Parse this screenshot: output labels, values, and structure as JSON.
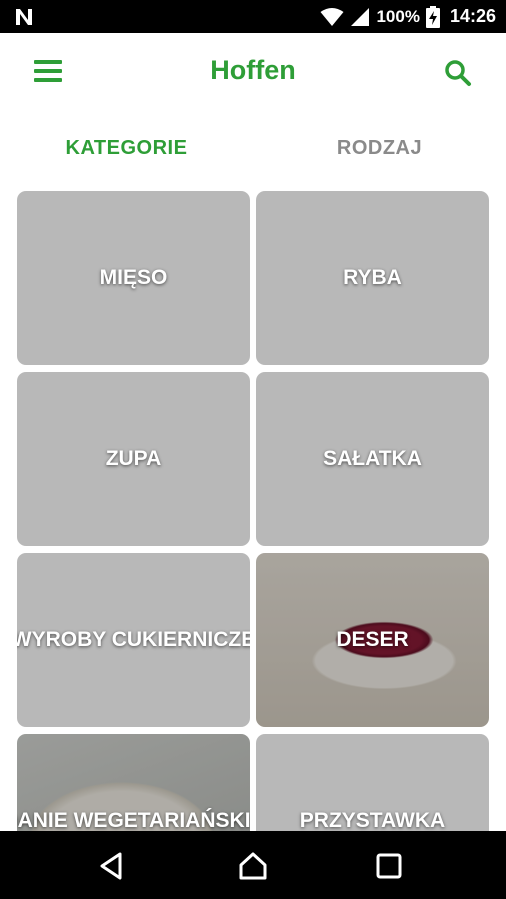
{
  "status_bar": {
    "battery_percent": "100%",
    "time": "14:26",
    "icons": [
      "n-icon",
      "wifi-icon",
      "signal-icon",
      "battery-charging-icon"
    ]
  },
  "app_bar": {
    "title": "Hoffen",
    "menu_icon": "hamburger-menu-icon",
    "search_icon": "search-icon"
  },
  "tabs": [
    {
      "label": "KATEGORIE",
      "active": true
    },
    {
      "label": "RODZAJ",
      "active": false
    }
  ],
  "categories": [
    {
      "label": "MIĘSO"
    },
    {
      "label": "RYBA"
    },
    {
      "label": "ZUPA"
    },
    {
      "label": "SAŁATKA"
    },
    {
      "label": "WYROBY CUKIERNICZE"
    },
    {
      "label": "DESER"
    },
    {
      "label": "DANIE WEGETARIAŃSKIE"
    },
    {
      "label": "PRZYSTAWKA"
    }
  ],
  "nav_bar": {
    "icons": [
      "back-icon",
      "home-icon",
      "recent-apps-icon"
    ]
  },
  "colors": {
    "accent": "#2e9e37",
    "inactive_tab": "#8a8a8a",
    "status_bar_bg": "#000000"
  }
}
